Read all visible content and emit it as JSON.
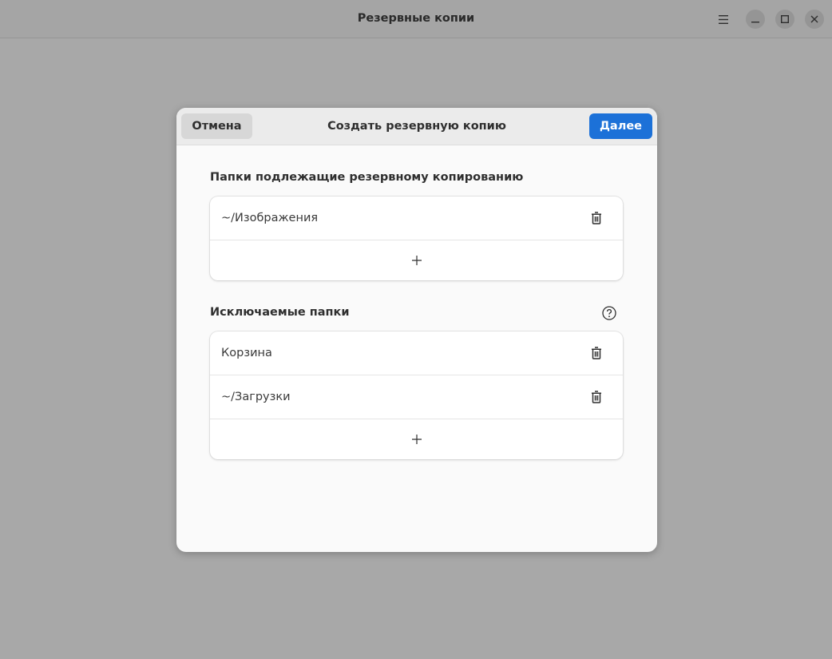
{
  "window": {
    "title": "Резервные копии",
    "icons": {
      "menu": "hamburger-menu-icon",
      "minimize": "minimize-icon",
      "maximize": "maximize-icon",
      "close": "close-icon"
    }
  },
  "dialog": {
    "title": "Создать резервную копию",
    "cancel_label": "Отмена",
    "next_label": "Далее",
    "accent_color": "#1c71d8",
    "include_section": {
      "title": "Папки подлежащие резервному копированию",
      "items": [
        {
          "label": "~/Изображения",
          "icon": "trash-icon"
        }
      ],
      "add_icon": "plus-icon"
    },
    "exclude_section": {
      "title": "Исключаемые папки",
      "help_icon": "help-icon",
      "items": [
        {
          "label": "Корзина",
          "icon": "trash-icon"
        },
        {
          "label": "~/Загрузки",
          "icon": "trash-icon"
        }
      ],
      "add_icon": "plus-icon"
    }
  }
}
